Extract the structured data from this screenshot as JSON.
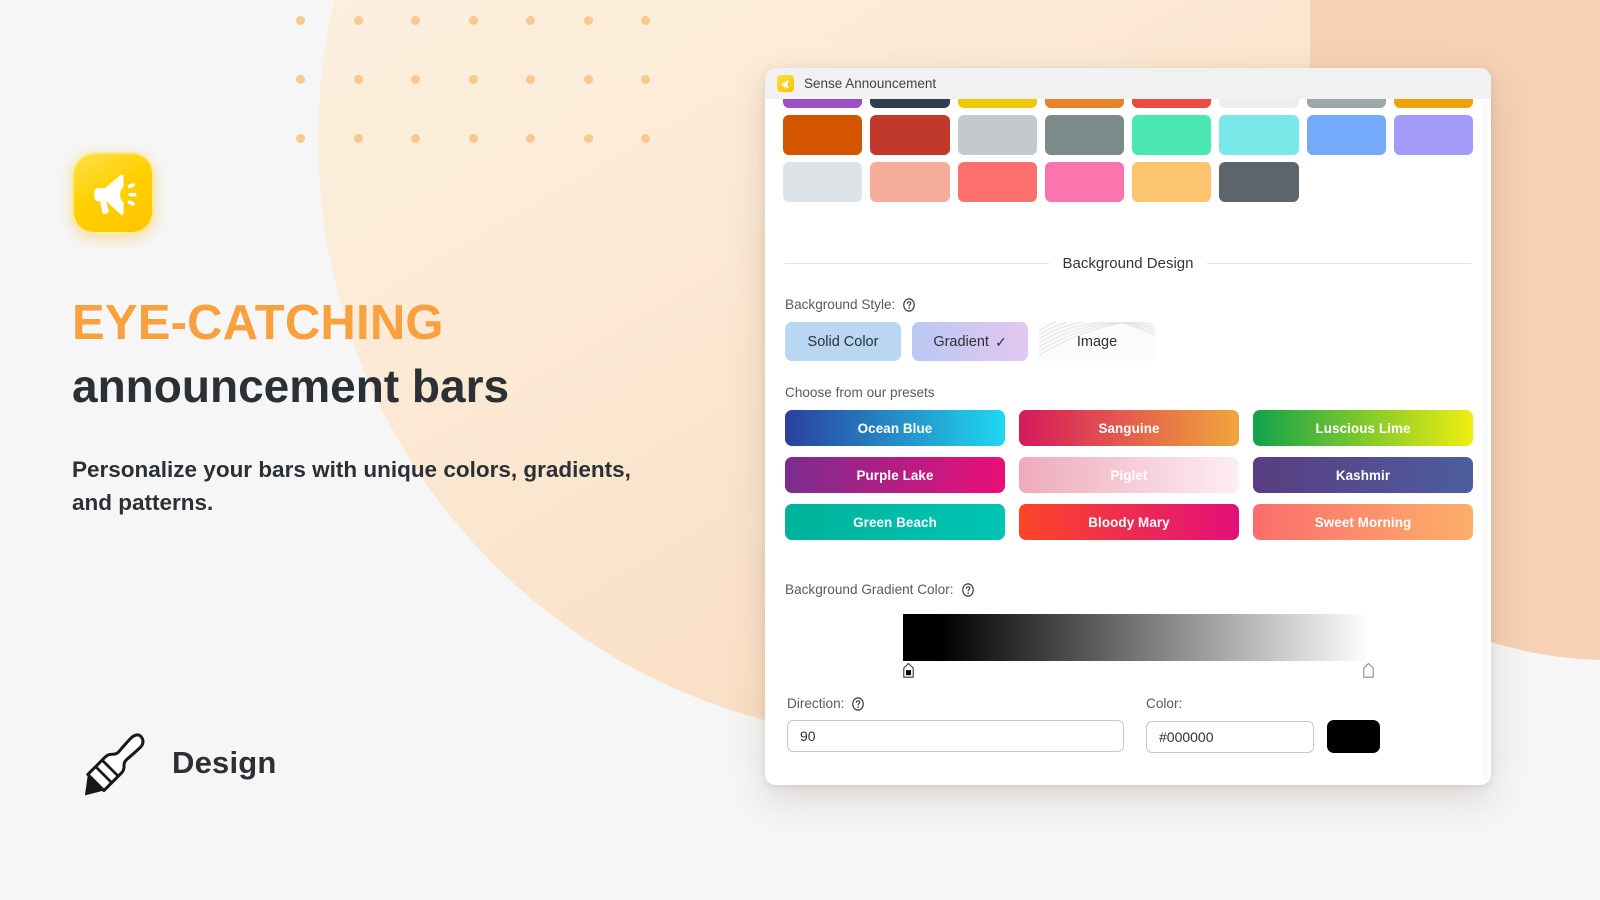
{
  "promo": {
    "logo_icon": "megaphone-icon",
    "headline_line1": "EYE-CATCHING",
    "headline_line2": "announcement bars",
    "subcopy": "Personalize your bars with unique colors, gradients, and patterns.",
    "badge_icon": "paintbrush-icon",
    "badge_label": "Design",
    "accent_color": "#F9A03F",
    "text_color": "#2b3035"
  },
  "window": {
    "favicon": "megaphone-icon",
    "title": "Sense Announcement"
  },
  "swatches": {
    "row1": [
      "#9b51c4",
      "#2f3e4e",
      "#f0c808",
      "#e8822a",
      "#e94b41",
      "#eceff0",
      "#9aa8a8",
      "#f0a008"
    ],
    "row2": [
      "#d45500",
      "#c0392b",
      "#c3c9cd",
      "#7d8a8a",
      "#4ae8b0",
      "#7ae8e8",
      "#74aaf9",
      "#a39bf7"
    ],
    "row3": [
      "#dde3e6",
      "#f7ad9c",
      "#fb6f6f",
      "#fb74ad",
      "#fcc46e",
      "#5c656c"
    ]
  },
  "background_design": {
    "section_title": "Background Design",
    "style_label": "Background Style:",
    "style_help_icon": "help-circle-icon",
    "styles": [
      {
        "id": "solid",
        "label": "Solid Color",
        "selected": false
      },
      {
        "id": "gradient",
        "label": "Gradient",
        "selected": true,
        "check": "✓"
      },
      {
        "id": "image",
        "label": "Image",
        "selected": false
      }
    ],
    "presets_caption": "Choose from our presets",
    "presets": [
      {
        "name": "Ocean Blue",
        "from": "#2b3f9e",
        "to": "#1fd8f0",
        "label_color": "#ffffff"
      },
      {
        "name": "Sanguine",
        "from": "#d6185c",
        "to": "#f0a63c",
        "label_color": "#ffffff"
      },
      {
        "name": "Luscious Lime",
        "from": "#11a24a",
        "to": "#eeee10",
        "label_color": "#ffffff"
      },
      {
        "name": "Purple Lake",
        "from": "#7b2d8e",
        "to": "#ea0f78",
        "label_color": "#ffffff"
      },
      {
        "name": "Piglet",
        "from": "#eeaabb",
        "to": "#fdeef2",
        "label_color": "#ffffff"
      },
      {
        "name": "Kashmir",
        "from": "#5a3d82",
        "to": "#4c5e9e",
        "label_color": "#ffffff"
      },
      {
        "name": "Green Beach",
        "from": "#00b29a",
        "to": "#00c4b4",
        "label_color": "#ffffff"
      },
      {
        "name": "Bloody Mary",
        "from": "#fb4628",
        "to": "#e2107a",
        "label_color": "#ffffff"
      },
      {
        "name": "Sweet Morning",
        "from": "#fb6d6d",
        "to": "#fcb06a",
        "label_color": "#ffffff"
      }
    ],
    "gradient_color_label": "Background Gradient Color:",
    "gradient_color_help_icon": "help-circle-icon",
    "gradient_stops": [
      "#000000",
      "#ffffff"
    ],
    "direction_label": "Direction:",
    "direction_help_icon": "help-circle-icon",
    "direction_value": "90",
    "color_label": "Color:",
    "color_value": "#000000",
    "color_chip": "#000000"
  }
}
